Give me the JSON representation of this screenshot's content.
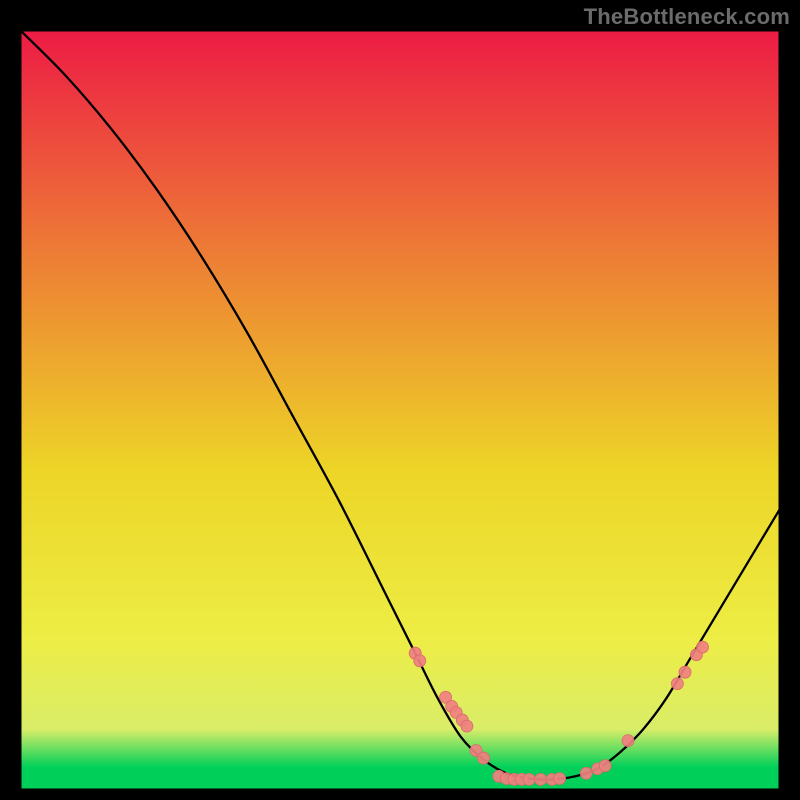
{
  "attribution": "TheBottleneck.com",
  "chart_data": {
    "type": "line",
    "title": "",
    "xlabel": "",
    "ylabel": "",
    "xlim": [
      0,
      100
    ],
    "ylim": [
      0,
      100
    ],
    "background_gradient": {
      "top": "#ff1d4a",
      "upper_mid": "#ff813a",
      "mid": "#ffe52a",
      "lower_mid": "#ffff4a",
      "lower_band": "#eaff70",
      "bottom": "#00e060"
    },
    "gradient_alpha": 0.93,
    "frame_stroke": "#000000",
    "frame_stroke_width": 2,
    "curve": {
      "stroke": "#000000",
      "stroke_width": 2.3,
      "points": [
        {
          "x": 0,
          "y": 100
        },
        {
          "x": 6,
          "y": 94
        },
        {
          "x": 12,
          "y": 87
        },
        {
          "x": 18,
          "y": 79
        },
        {
          "x": 24,
          "y": 70
        },
        {
          "x": 30,
          "y": 60
        },
        {
          "x": 36,
          "y": 49
        },
        {
          "x": 42,
          "y": 38
        },
        {
          "x": 48,
          "y": 26
        },
        {
          "x": 52,
          "y": 18
        },
        {
          "x": 55,
          "y": 12
        },
        {
          "x": 58,
          "y": 7
        },
        {
          "x": 61,
          "y": 4
        },
        {
          "x": 64,
          "y": 2.2
        },
        {
          "x": 67,
          "y": 1.5
        },
        {
          "x": 70,
          "y": 1.4
        },
        {
          "x": 73,
          "y": 1.8
        },
        {
          "x": 76,
          "y": 2.8
        },
        {
          "x": 79,
          "y": 5
        },
        {
          "x": 82,
          "y": 8
        },
        {
          "x": 85,
          "y": 12
        },
        {
          "x": 88,
          "y": 17
        },
        {
          "x": 91,
          "y": 22
        },
        {
          "x": 94,
          "y": 27
        },
        {
          "x": 97,
          "y": 32
        },
        {
          "x": 100,
          "y": 37
        }
      ]
    },
    "markers": {
      "fill": "#f08080",
      "stroke": "#d86a6a",
      "radius": 6,
      "points": [
        {
          "x": 52,
          "y": 18
        },
        {
          "x": 52.6,
          "y": 17
        },
        {
          "x": 56,
          "y": 12.2
        },
        {
          "x": 56.8,
          "y": 11
        },
        {
          "x": 57.4,
          "y": 10.2
        },
        {
          "x": 58.2,
          "y": 9.2
        },
        {
          "x": 58.8,
          "y": 8.4
        },
        {
          "x": 60,
          "y": 5.2
        },
        {
          "x": 61,
          "y": 4.2
        },
        {
          "x": 63,
          "y": 1.8
        },
        {
          "x": 64,
          "y": 1.5
        },
        {
          "x": 65,
          "y": 1.4
        },
        {
          "x": 66,
          "y": 1.4
        },
        {
          "x": 67,
          "y": 1.4
        },
        {
          "x": 68.5,
          "y": 1.4
        },
        {
          "x": 70,
          "y": 1.4
        },
        {
          "x": 71,
          "y": 1.5
        },
        {
          "x": 74.5,
          "y": 2.2
        },
        {
          "x": 76,
          "y": 2.8
        },
        {
          "x": 77,
          "y": 3.2
        },
        {
          "x": 80,
          "y": 6.5
        },
        {
          "x": 86.5,
          "y": 14
        },
        {
          "x": 87.5,
          "y": 15.5
        },
        {
          "x": 89,
          "y": 17.8
        },
        {
          "x": 89.8,
          "y": 18.8
        }
      ]
    }
  }
}
